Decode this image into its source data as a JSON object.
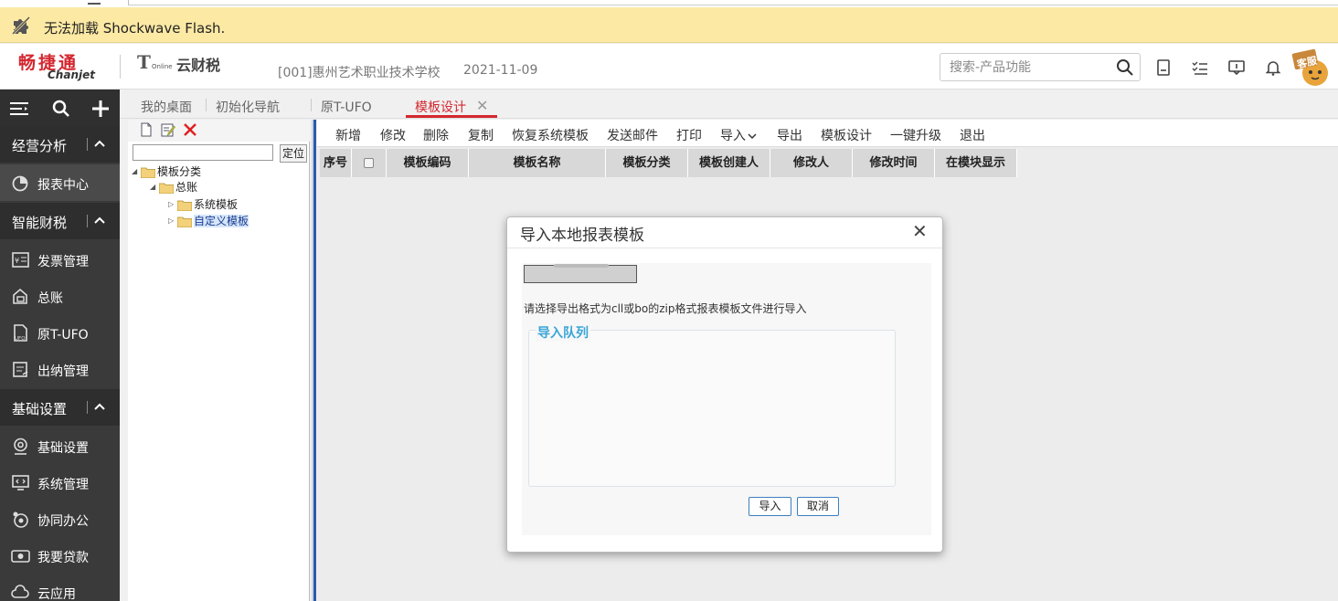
{
  "flash_bar": {
    "message": "无法加载 Shockwave Flash."
  },
  "header": {
    "logo_cn": "畅捷通",
    "logo_en": "Chanjet",
    "product_t": "T",
    "product_sub": "Online",
    "product_name": "云财税",
    "company": "[001]惠州艺术职业技术学校",
    "date": "2021-11-09",
    "search_placeholder": "搜索-产品功能",
    "service_badge": "客服"
  },
  "sidebar": {
    "groups": [
      {
        "label": "经营分析",
        "items": [
          {
            "label": "报表中心",
            "icon": "pie-chart-icon"
          }
        ]
      },
      {
        "label": "智能财税",
        "items": [
          {
            "label": "发票管理",
            "icon": "invoice-icon"
          },
          {
            "label": "总账",
            "icon": "ledger-icon"
          },
          {
            "label": "原T-UFO",
            "icon": "ufo-doc-icon"
          },
          {
            "label": "出纳管理",
            "icon": "cashier-icon"
          }
        ]
      },
      {
        "label": "基础设置",
        "items": [
          {
            "label": "基础设置",
            "icon": "settings-icon"
          },
          {
            "label": "系统管理",
            "icon": "code-monitor-icon"
          },
          {
            "label": "协同办公",
            "icon": "collab-icon"
          },
          {
            "label": "我要贷款",
            "icon": "money-icon"
          },
          {
            "label": "云应用",
            "icon": "cloud-icon"
          }
        ]
      }
    ]
  },
  "tabs": [
    {
      "label": "我的桌面"
    },
    {
      "label": "初始化导航"
    },
    {
      "label": "原T-UFO"
    },
    {
      "label": "模板设计",
      "active": true
    }
  ],
  "tree": {
    "locate_label": "定位",
    "search_value": "",
    "root": "模板分类",
    "child": "总账",
    "leaves": [
      "系统模板",
      "自定义模板"
    ]
  },
  "toolbar": [
    "新增",
    "修改",
    "删除",
    "复制",
    "恢复系统模板",
    "发送邮件",
    "打印",
    "导入",
    "导出",
    "模板设计",
    "一键升级",
    "退出"
  ],
  "grid_columns": [
    "序号",
    "",
    "模板编码",
    "模板名称",
    "模板分类",
    "模板创建人",
    "修改人",
    "修改时间",
    "在模块显示"
  ],
  "modal": {
    "title": "导入本地报表模板",
    "hint": "请选择导出格式为cll或bo的zip格式报表模板文件进行导入",
    "queue_label": "导入队列",
    "import_label": "导入",
    "cancel_label": "取消"
  },
  "colors": {
    "brand_red": "#d4272f",
    "sidebar_bg": "#3a3a3a",
    "link_blue": "#3aa6d8"
  }
}
